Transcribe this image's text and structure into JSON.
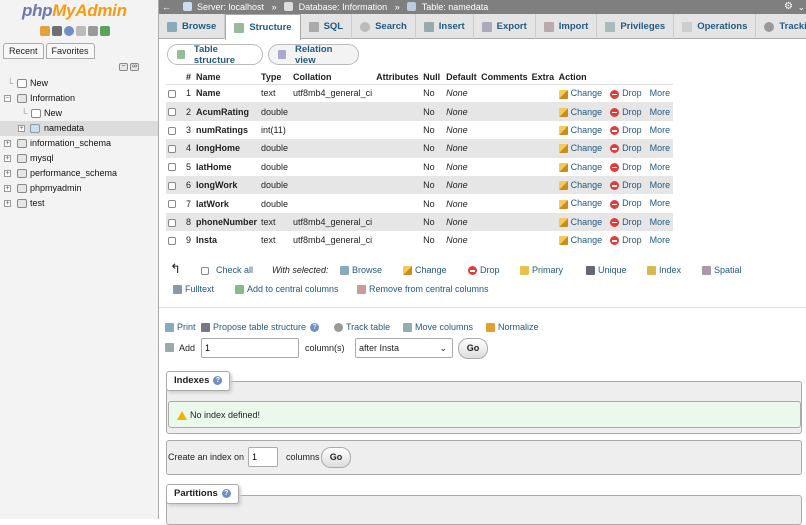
{
  "logo": {
    "php": "php",
    "my": "MyAdmin"
  },
  "nav_tabs": [
    "Recent",
    "Favorites"
  ],
  "tree": [
    {
      "label": "New",
      "level": 1
    },
    {
      "label": "Information",
      "level": 0
    },
    {
      "label": "New",
      "level": 2
    },
    {
      "label": "namedata",
      "level": 2
    },
    {
      "label": "information_schema",
      "level": 0
    },
    {
      "label": "mysql",
      "level": 0
    },
    {
      "label": "performance_schema",
      "level": 0
    },
    {
      "label": "phpmyadmin",
      "level": 0
    },
    {
      "label": "test",
      "level": 0
    }
  ],
  "breadcrumb": {
    "server": "Server: localhost",
    "database": "Database: Information",
    "table": "Table: namedata",
    "sep": "»"
  },
  "tabs": [
    "Browse",
    "Structure",
    "SQL",
    "Search",
    "Insert",
    "Export",
    "Import",
    "Privileges",
    "Operations",
    "Tracking"
  ],
  "subtabs": {
    "structure": "Table structure",
    "relation": "Relation view"
  },
  "table": {
    "headers": [
      "#",
      "Name",
      "Type",
      "Collation",
      "Attributes",
      "Null",
      "Default",
      "Comments",
      "Extra",
      "Action"
    ],
    "rows": [
      {
        "num": "1",
        "name": "Name",
        "type": "text",
        "collation": "utf8mb4_general_ci",
        "null": "No",
        "default": "None"
      },
      {
        "num": "2",
        "name": "AcumRating",
        "type": "double",
        "collation": "",
        "null": "No",
        "default": "None"
      },
      {
        "num": "3",
        "name": "numRatings",
        "type": "int(11)",
        "collation": "",
        "null": "No",
        "default": "None"
      },
      {
        "num": "4",
        "name": "longHome",
        "type": "double",
        "collation": "",
        "null": "No",
        "default": "None"
      },
      {
        "num": "5",
        "name": "latHome",
        "type": "double",
        "collation": "",
        "null": "No",
        "default": "None"
      },
      {
        "num": "6",
        "name": "longWork",
        "type": "double",
        "collation": "",
        "null": "No",
        "default": "None"
      },
      {
        "num": "7",
        "name": "latWork",
        "type": "double",
        "collation": "",
        "null": "No",
        "default": "None"
      },
      {
        "num": "8",
        "name": "phoneNumber",
        "type": "text",
        "collation": "utf8mb4_general_ci",
        "null": "No",
        "default": "None"
      },
      {
        "num": "9",
        "name": "Insta",
        "type": "text",
        "collation": "utf8mb4_general_ci",
        "null": "No",
        "default": "None"
      }
    ],
    "actions": {
      "change": "Change",
      "drop": "Drop",
      "more": "More"
    }
  },
  "with_selected": {
    "check_all": "Check all",
    "label": "With selected:",
    "browse": "Browse",
    "change": "Change",
    "drop": "Drop",
    "primary": "Primary",
    "unique": "Unique",
    "index": "Index",
    "spatial": "Spatial",
    "fulltext": "Fulltext",
    "add_central": "Add to central columns",
    "remove_central": "Remove from central columns"
  },
  "toolbar2": {
    "print": "Print",
    "propose": "Propose table structure",
    "track": "Track table",
    "move": "Move columns",
    "normalize": "Normalize"
  },
  "add_column": {
    "label": "Add",
    "count": "1",
    "columns_label": "column(s)",
    "position": "after Insta",
    "go": "Go"
  },
  "indexes": {
    "legend": "Indexes",
    "message": "No index defined!",
    "create_label": "Create an index on",
    "create_count": "1",
    "columns_label": "columns",
    "go": "Go"
  },
  "partitions": {
    "legend": "Partitions"
  }
}
